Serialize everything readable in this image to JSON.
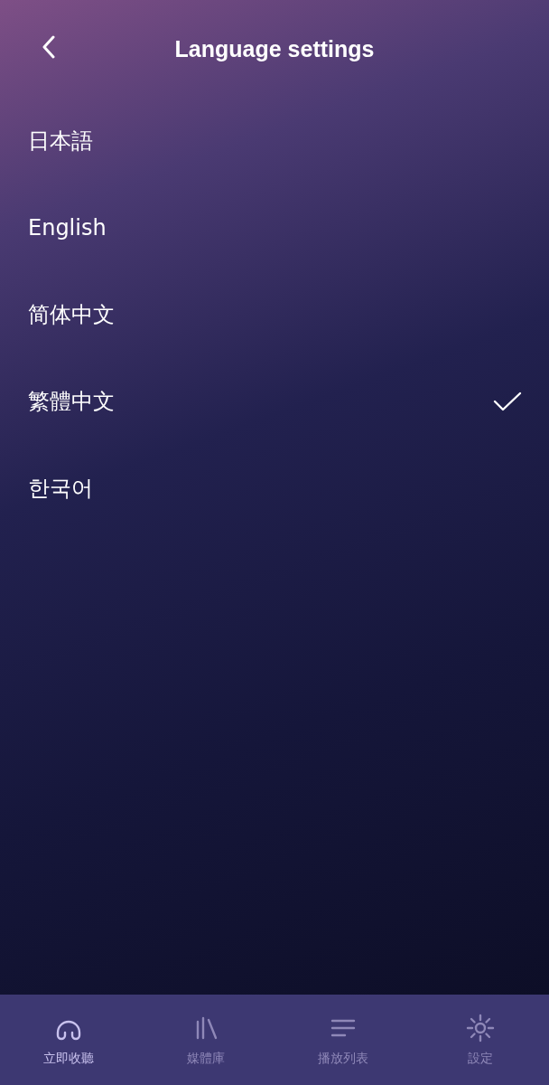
{
  "header": {
    "title": "Language settings"
  },
  "languages": [
    {
      "label": "日本語",
      "selected": false
    },
    {
      "label": "English",
      "selected": false
    },
    {
      "label": "简体中文",
      "selected": false
    },
    {
      "label": "繁體中文",
      "selected": true
    },
    {
      "label": "한국어",
      "selected": false
    }
  ],
  "tab_bar": [
    {
      "kind": "listen",
      "label": "立即收聽",
      "selected": true
    },
    {
      "kind": "library",
      "label": "媒體庫",
      "selected": false
    },
    {
      "kind": "playlist",
      "label": "播放列表",
      "selected": false
    },
    {
      "kind": "settings",
      "label": "設定",
      "selected": false
    }
  ]
}
